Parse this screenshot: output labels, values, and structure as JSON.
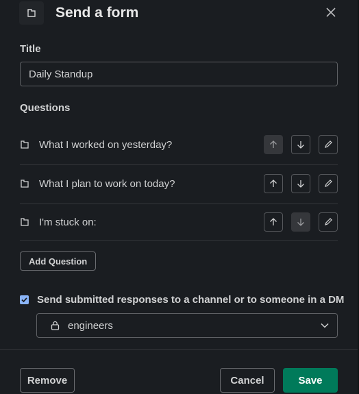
{
  "modal": {
    "title": "Send a form",
    "icon": "form-icon",
    "close_icon": "close-icon"
  },
  "title_field": {
    "label": "Title",
    "value": "Daily Standup"
  },
  "questions": {
    "label": "Questions",
    "items": [
      {
        "text": "What I worked on yesterday?",
        "up_disabled": true,
        "down_disabled": false
      },
      {
        "text": "What I plan to work on today?",
        "up_disabled": false,
        "down_disabled": false
      },
      {
        "text": "I'm stuck on:",
        "up_disabled": false,
        "down_disabled": true
      }
    ],
    "add_label": "Add Question"
  },
  "send_option": {
    "checked": true,
    "label": "Send submitted responses to a channel or to someone in a DM",
    "channel": "engineers",
    "channel_icon": "lock-icon"
  },
  "footer": {
    "remove_label": "Remove",
    "cancel_label": "Cancel",
    "save_label": "Save"
  },
  "colors": {
    "background": "#1a1d21",
    "primary": "#007a5a",
    "checkbox": "#8ab4f8"
  }
}
